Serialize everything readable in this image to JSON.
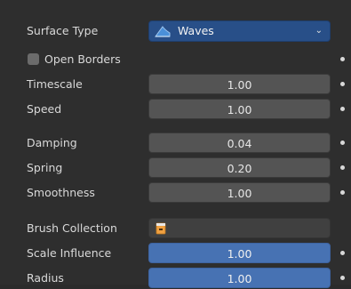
{
  "surface_type": {
    "label": "Surface Type",
    "value": "Waves",
    "icon": "waves-icon",
    "chevron": "⌄"
  },
  "open_borders": {
    "label": "Open Borders",
    "checked": false
  },
  "rows": {
    "timescale": {
      "label": "Timescale",
      "value": "1.00"
    },
    "speed": {
      "label": "Speed",
      "value": "1.00"
    },
    "damping": {
      "label": "Damping",
      "value": "0.04"
    },
    "spring": {
      "label": "Spring",
      "value": "0.20"
    },
    "smoothness": {
      "label": "Smoothness",
      "value": "1.00"
    },
    "brush_collection": {
      "label": "Brush Collection",
      "icon": "collection-icon"
    },
    "scale_influence": {
      "label": "Scale Influence",
      "value": "1.00"
    },
    "radius": {
      "label": "Radius",
      "value": "1.00"
    }
  },
  "colors": {
    "accent": "#4772b3",
    "dropdown": "#284f88",
    "panel": "#2e2e2e"
  }
}
